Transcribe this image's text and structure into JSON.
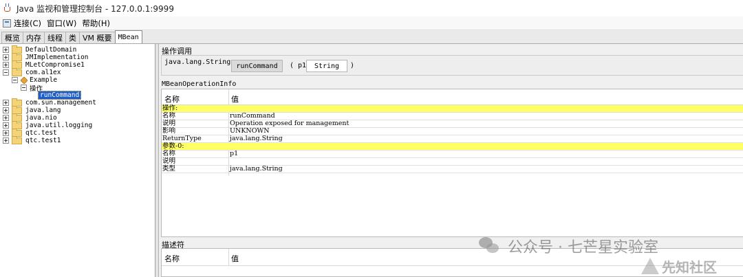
{
  "window": {
    "title": "Java 监视和管理控制台 - 127.0.0.1:9999"
  },
  "menubar": {
    "items": [
      "连接(C)",
      "窗口(W)",
      "帮助(H)"
    ]
  },
  "tabs": [
    "概览",
    "内存",
    "线程",
    "类",
    "VM 概要",
    "MBean"
  ],
  "active_tab": "MBean",
  "tree": {
    "items": [
      {
        "label": "DefaultDomain",
        "expanded": false,
        "icon": "folder-icon"
      },
      {
        "label": "JMImplementation",
        "expanded": false,
        "icon": "folder-icon"
      },
      {
        "label": "MLetCompromise1",
        "expanded": false,
        "icon": "folder-icon"
      },
      {
        "label": "com.al1ex",
        "expanded": true,
        "icon": "folder-icon"
      },
      {
        "label": "Example",
        "expanded": true,
        "icon": "bean-icon"
      },
      {
        "label": "操作",
        "expanded": true,
        "icon": "none"
      },
      {
        "label": "runCommand",
        "selected": true,
        "icon": "none"
      },
      {
        "label": "com.sun.management",
        "expanded": false,
        "icon": "folder-icon"
      },
      {
        "label": "java.lang",
        "expanded": false,
        "icon": "folder-icon"
      },
      {
        "label": "java.nio",
        "expanded": false,
        "icon": "folder-icon"
      },
      {
        "label": "java.util.logging",
        "expanded": false,
        "icon": "folder-icon"
      },
      {
        "label": "qtc.test",
        "expanded": false,
        "icon": "folder-icon"
      },
      {
        "label": "qtc.test1",
        "expanded": false,
        "icon": "folder-icon"
      }
    ]
  },
  "operation_invocation": {
    "title": "操作调用",
    "return_type": "java.lang.String",
    "button_label": "runCommand",
    "paren_open": "( p1",
    "param_value": "String",
    "paren_close": ")"
  },
  "operation_info": {
    "title": "MBeanOperationInfo",
    "headers": {
      "name": "名称",
      "value": "值"
    },
    "rows": [
      {
        "name": "操作:",
        "value": "",
        "section": true
      },
      {
        "name": "名称",
        "value": "runCommand"
      },
      {
        "name": "说明",
        "value": "Operation exposed for management"
      },
      {
        "name": "影响",
        "value": "UNKNOWN"
      },
      {
        "name": "ReturnType",
        "value": "java.lang.String"
      },
      {
        "name": "参数-0:",
        "value": "",
        "section": true
      },
      {
        "name": "名称",
        "value": "p1"
      },
      {
        "name": "说明",
        "value": ""
      },
      {
        "name": "类型",
        "value": "java.lang.String"
      }
    ]
  },
  "descriptor": {
    "title": "描述符",
    "headers": {
      "name": "名称",
      "value": "值"
    }
  },
  "watermarks": {
    "wechat": "公众号 · 七芒星实验室",
    "xianzhi": "先知社区"
  },
  "colors": {
    "section_highlight": "#ffff66",
    "selection": "#1f5ec9"
  }
}
